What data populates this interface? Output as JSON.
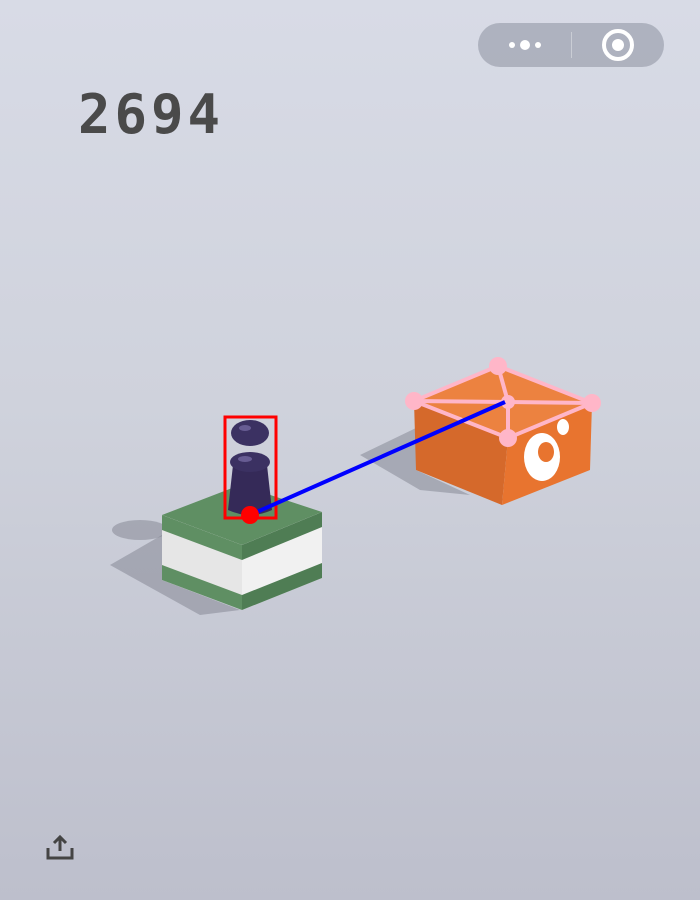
{
  "hud": {
    "score": "2694",
    "capsule": {
      "more_icon": "more-dots-icon",
      "close_icon": "close-circle-icon"
    },
    "share_icon": "share-upload-icon"
  },
  "colors": {
    "background_top": "#d8dbe6",
    "background_bottom": "#bdbfcc",
    "score": "#4a4a4a",
    "player": "#3a2f5c",
    "start_block_green": "#5f8f63",
    "start_block_white": "#e6e6e6",
    "target_block": "#e8742f",
    "player_bbox": "#ff0000",
    "aim_line": "#0000ff",
    "target_outline": "#ffb6c8"
  }
}
